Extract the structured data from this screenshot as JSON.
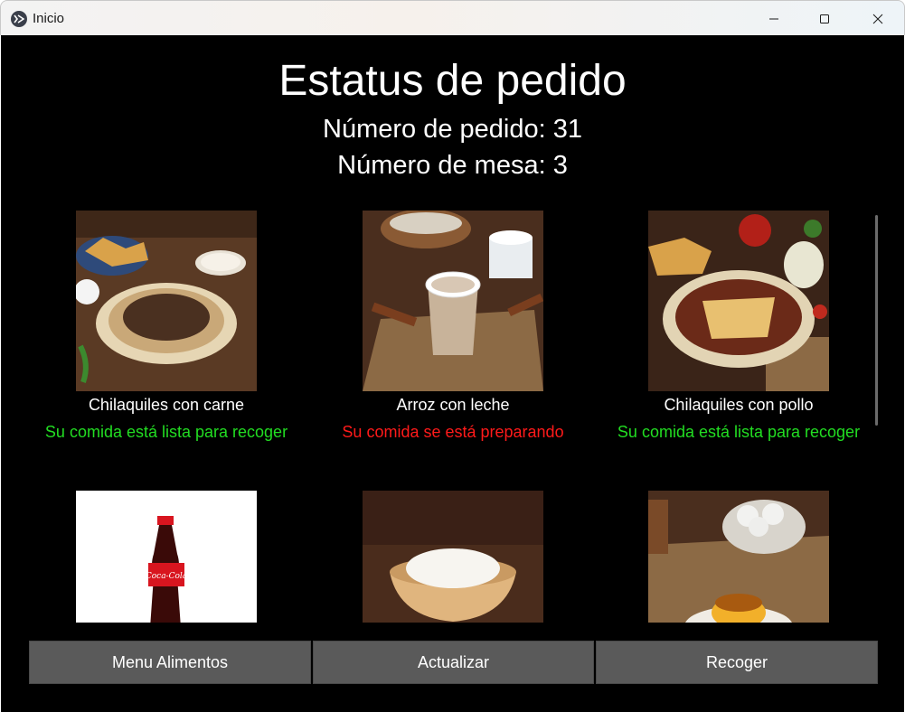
{
  "window": {
    "title": "Inicio",
    "icon": "kivy-app-icon",
    "controls": [
      "minimize-icon",
      "maximize-icon",
      "close-icon"
    ]
  },
  "header": {
    "title": "Estatus de pedido",
    "order_number": "Número de pedido: 31",
    "table_number": "Número de mesa: 3"
  },
  "colors": {
    "background": "#000000",
    "ready": "#22dd22",
    "preparing": "#ff1a1a",
    "button": "#5a5a5a"
  },
  "items": [
    {
      "name": "Chilaquiles con carne",
      "status": "Su comida está lista para recoger",
      "state": "ready",
      "image": "chilaquiles-carne-photo"
    },
    {
      "name": "Arroz con leche",
      "status": "Su comida se está preparando",
      "state": "preparing",
      "image": "arroz-con-leche-photo"
    },
    {
      "name": "Chilaquiles con pollo",
      "status": "Su comida está lista para recoger",
      "state": "ready",
      "image": "chilaquiles-pollo-photo"
    },
    {
      "name": "",
      "status": "",
      "state": "",
      "image": "coca-cola-bottle-photo"
    },
    {
      "name": "",
      "status": "",
      "state": "",
      "image": "crema-bowl-photo"
    },
    {
      "name": "",
      "status": "",
      "state": "",
      "image": "flan-photo"
    }
  ],
  "buttons": {
    "menu": "Menu Alimentos",
    "refresh": "Actualizar",
    "pickup": "Recoger"
  }
}
